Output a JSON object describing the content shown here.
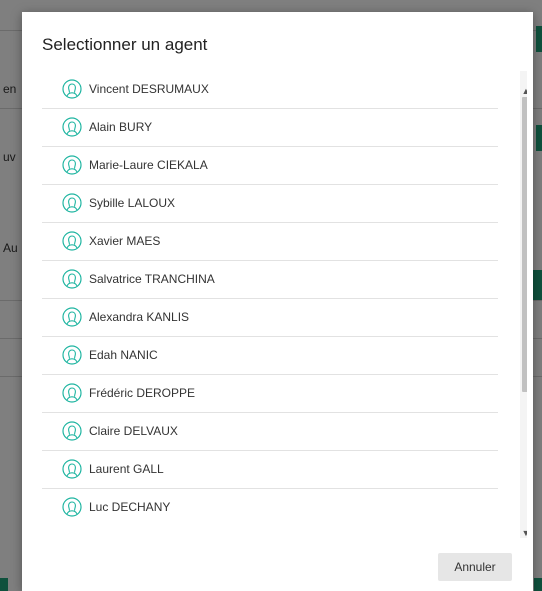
{
  "background": {
    "fragments": [
      {
        "text": "en",
        "id": "bg-fragment-1"
      },
      {
        "text": "uv",
        "id": "bg-fragment-2"
      },
      {
        "text": "Au",
        "id": "bg-fragment-3"
      },
      {
        "text": "é",
        "id": "bg-fragment-4"
      }
    ],
    "accent_color": "#1fa37a"
  },
  "modal": {
    "title": "Selectionner un agent",
    "agents": [
      {
        "name": "Vincent DESRUMAUX",
        "icon": "user-icon"
      },
      {
        "name": "Alain BURY",
        "icon": "user-icon"
      },
      {
        "name": "Marie-Laure CIEKALA",
        "icon": "user-icon"
      },
      {
        "name": "Sybille LALOUX",
        "icon": "user-icon"
      },
      {
        "name": "Xavier MAES",
        "icon": "user-icon"
      },
      {
        "name": "Salvatrice TRANCHINA",
        "icon": "user-icon"
      },
      {
        "name": "Alexandra KANLIS",
        "icon": "user-icon"
      },
      {
        "name": "Edah NANIC",
        "icon": "user-icon"
      },
      {
        "name": "Frédéric DEROPPE",
        "icon": "user-icon"
      },
      {
        "name": "Claire DELVAUX",
        "icon": "user-icon"
      },
      {
        "name": "Laurent GALL",
        "icon": "user-icon"
      },
      {
        "name": "Luc DECHANY",
        "icon": "user-icon"
      }
    ],
    "icon_color": "#1fb5a1",
    "cancel_label": "Annuler"
  }
}
